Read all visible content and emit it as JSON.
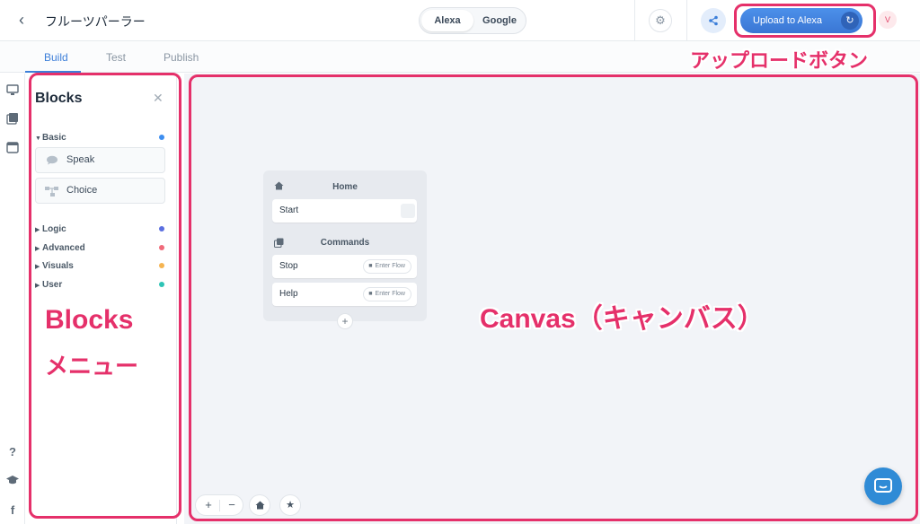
{
  "header": {
    "back_icon": "chevron-left-icon",
    "project_name": "フルーツパーラー",
    "platform_toggle": [
      "Alexa",
      "Google"
    ],
    "settings_icon": "gear-icon",
    "share_icon": "share-icon",
    "upload_label": "Upload to Alexa",
    "sync_icon": "sync-icon",
    "avatar_initial": "V"
  },
  "tabs": [
    "Build",
    "Test",
    "Publish"
  ],
  "active_tab": "Build",
  "left_strip_icons": [
    "monitor-icon",
    "library-icon",
    "code-window-icon",
    "help-icon",
    "graduation-cap-icon",
    "facebook-icon"
  ],
  "blocks_panel": {
    "title": "Blocks",
    "basic": {
      "label": "Basic",
      "color": "#3d8ef0",
      "items": [
        {
          "label": "Speak",
          "icon": "speech-bubble-icon"
        },
        {
          "label": "Choice",
          "icon": "branch-icon"
        }
      ]
    },
    "sections": [
      {
        "label": "Logic",
        "color": "#5b6fe0"
      },
      {
        "label": "Advanced",
        "color": "#f06a7a"
      },
      {
        "label": "Visuals",
        "color": "#f5b451"
      },
      {
        "label": "User",
        "color": "#2ec4b6"
      }
    ]
  },
  "canvas": {
    "node": {
      "home_title": "Home",
      "start_label": "Start",
      "commands_title": "Commands",
      "commands": [
        {
          "label": "Stop",
          "action": "Enter Flow"
        },
        {
          "label": "Help",
          "action": "Enter Flow"
        }
      ]
    },
    "zoom_in": "+",
    "zoom_out": "−",
    "home_button_icon": "home-icon",
    "favorite_button_icon": "star-icon",
    "chat_icon": "chat-icon"
  },
  "annotations": {
    "upload_button": "アップロードボタン",
    "blocks_menu_line1": "Blocks",
    "blocks_menu_line2": "メニュー",
    "canvas": "Canvas（キャンバス）",
    "color": "#e5306a"
  }
}
